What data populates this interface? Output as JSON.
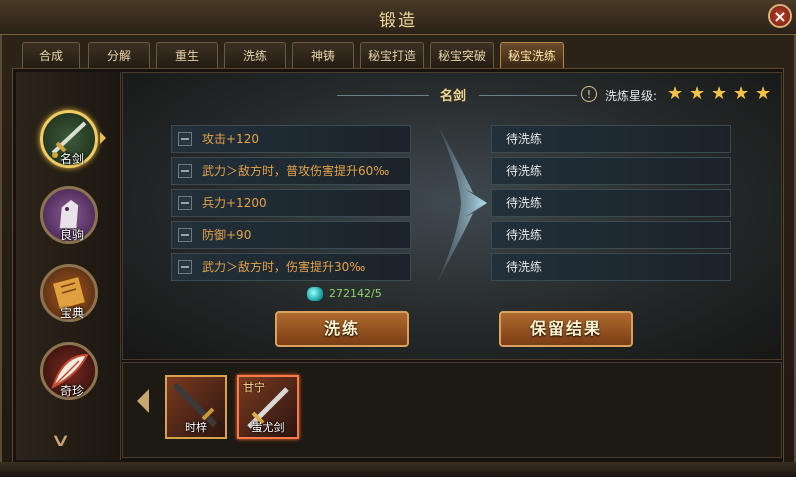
{
  "window": {
    "title": "锻造",
    "close": "×"
  },
  "tabs": [
    {
      "label": "合成"
    },
    {
      "label": "分解"
    },
    {
      "label": "重生"
    },
    {
      "label": "洗练"
    },
    {
      "label": "神铸"
    },
    {
      "label": "秘宝打造"
    },
    {
      "label": "秘宝突破"
    },
    {
      "label": "秘宝洗练",
      "active": true
    }
  ],
  "sidebar": {
    "items": [
      {
        "label": "名剑",
        "icon": "sword-icon",
        "active": true
      },
      {
        "label": "良驹",
        "icon": "horse-icon"
      },
      {
        "label": "宝典",
        "icon": "book-icon"
      },
      {
        "label": "奇珍",
        "icon": "feather-icon"
      }
    ]
  },
  "stage": {
    "item_name": "名剑",
    "stars_label": "洗炼星级:",
    "stars": 5,
    "current_attrs": [
      "攻击+120",
      "武力＞敌方时，普攻伤害提升60‰",
      "兵力+1200",
      "防御+90",
      "武力＞敌方时，伤害提升30‰"
    ],
    "pending_attrs": [
      "待洗练",
      "待洗练",
      "待洗练",
      "待洗练",
      "待洗练"
    ],
    "cost": "272142/5",
    "refine_button": "洗练",
    "keep_button": "保留结果"
  },
  "bag": {
    "items": [
      {
        "name": "时梓",
        "owner": ""
      },
      {
        "name": "蚩尤剑",
        "owner": "甘宁",
        "selected": true
      }
    ]
  },
  "colors": {
    "accent": "#f0cc64",
    "attr_text": "#e5a24a",
    "cost_text": "#8fd36a"
  }
}
